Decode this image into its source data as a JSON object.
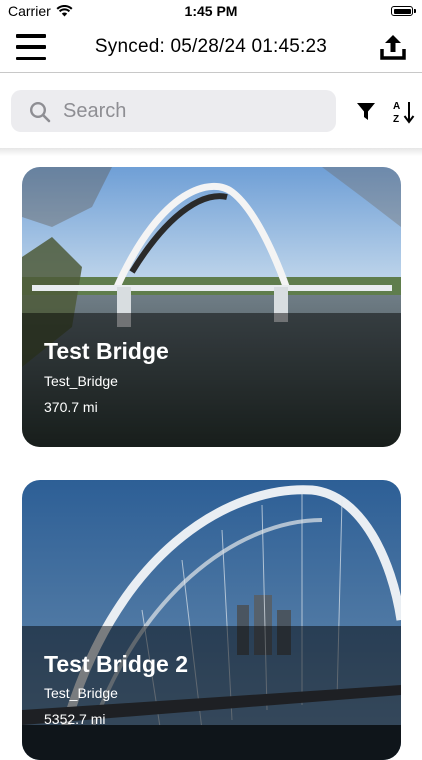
{
  "status_bar": {
    "carrier": "Carrier",
    "time": "1:45 PM"
  },
  "header": {
    "title": "Synced: 05/28/24 01:45:23"
  },
  "search": {
    "placeholder": "Search",
    "value": ""
  },
  "cards": [
    {
      "name": "Test Bridge",
      "id": "Test_Bridge",
      "distance": "370.7 mi"
    },
    {
      "name": "Test Bridge 2",
      "id": "Test_Bridge",
      "distance": "5352.7 mi"
    }
  ],
  "colors": {
    "accent": "#000000",
    "search_bg": "#ececef",
    "placeholder": "#8e8e93"
  },
  "icons": [
    "wifi-icon",
    "battery-icon",
    "menu-icon",
    "upload-icon",
    "search-icon",
    "filter-icon",
    "sort-az-icon"
  ]
}
